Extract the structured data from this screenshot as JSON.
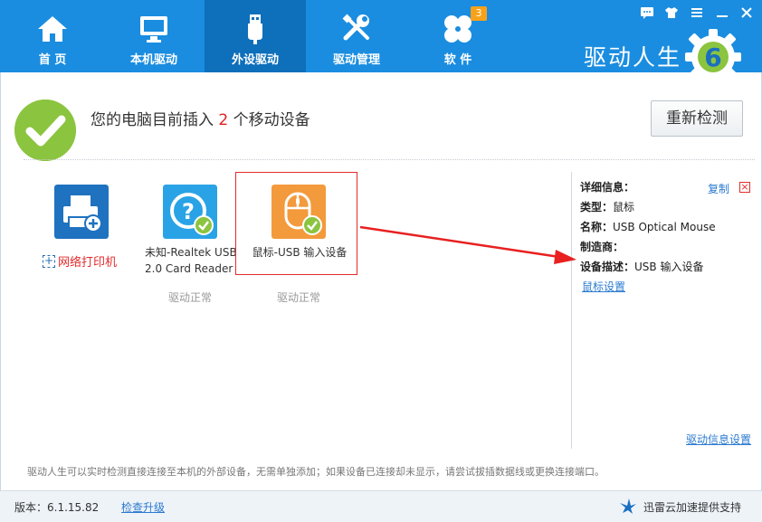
{
  "app": {
    "brand": "驱动人生",
    "version_label": "版本：6.1.15.82"
  },
  "tabs": [
    {
      "label": "首 页",
      "icon": "home-icon"
    },
    {
      "label": "本机驱动",
      "icon": "monitor-icon"
    },
    {
      "label": "外设驱动",
      "icon": "usb-icon",
      "active": true
    },
    {
      "label": "驱动管理",
      "icon": "tools-icon"
    },
    {
      "label": "软 件",
      "icon": "clover-icon",
      "badge": "3"
    }
  ],
  "window_controls": [
    "message-icon",
    "skin-icon",
    "menu-icon",
    "minimize-icon",
    "close-icon"
  ],
  "status": {
    "prefix": "您的电脑目前插入",
    "count": "2",
    "suffix": "个移动设备",
    "recheck_label": "重新检测"
  },
  "devices": [
    {
      "name": "网络打印机",
      "icon": "printer-icon"
    },
    {
      "name_line1": "未知-Realtek USB",
      "name_line2": "2.0 Card Reader",
      "status": "驱动正常",
      "icon": "unknown-device-icon"
    },
    {
      "name": "鼠标-USB 输入设备",
      "status": "驱动正常",
      "icon": "mouse-icon",
      "selected": true
    }
  ],
  "detail": {
    "title": "详细信息：",
    "copy_label": "复制",
    "rows": [
      {
        "key": "类型：",
        "value": "鼠标"
      },
      {
        "key": "名称：",
        "value": "USB Optical Mouse"
      },
      {
        "key": "制造商：",
        "value": ""
      },
      {
        "key": "设备描述：",
        "value": "USB 输入设备"
      }
    ],
    "mouse_settings_label": "鼠标设置",
    "driver_info_label": "驱动信息设置"
  },
  "hint": "驱动人生可以实时检测直接连接至本机的外部设备，无需单独添加；如果设备已连接却未显示，请尝试拔插数据线或更换连接端口。",
  "footer": {
    "upgrade_label": "检查升级",
    "xunlei_label": "迅雷云加速提供支持"
  },
  "colors": {
    "topbar": "#1a8de0",
    "active_tab": "#0e6fbb",
    "accent_red": "#e32b2b",
    "check_green": "#8bc43f",
    "link_blue": "#2a7ad0"
  }
}
